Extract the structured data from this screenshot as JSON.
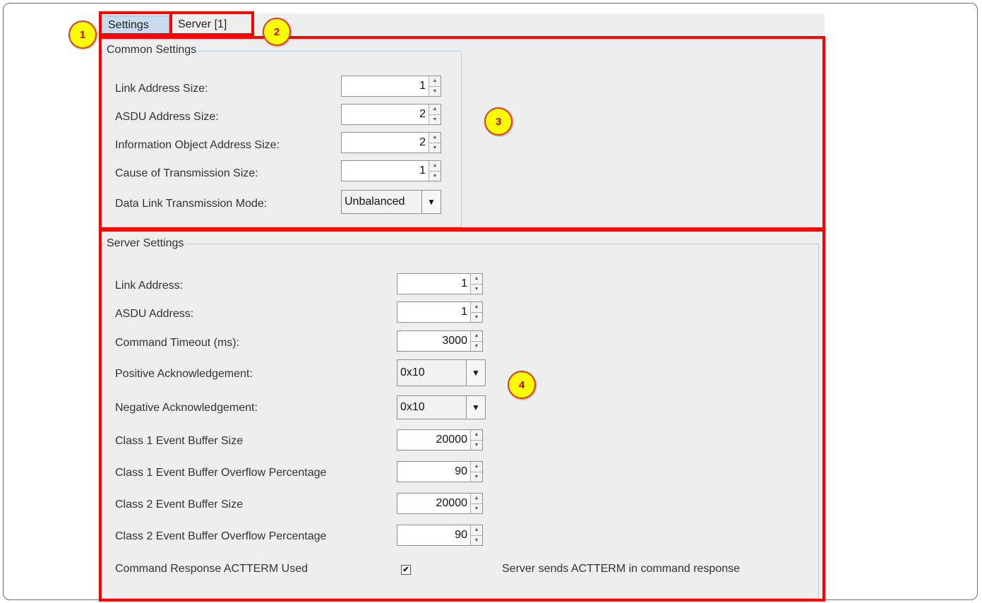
{
  "tabs": [
    {
      "label": "Settings",
      "active": true
    },
    {
      "label": "Server [1]",
      "active": false
    }
  ],
  "markers": [
    "1",
    "2",
    "3",
    "4"
  ],
  "common_settings": {
    "title": "Common Settings",
    "link_address_size": {
      "label": "Link Address Size:",
      "value": "1"
    },
    "asdu_address_size": {
      "label": "ASDU Address Size:",
      "value": "2"
    },
    "ioa_size": {
      "label": "Information Object Address Size:",
      "value": "2"
    },
    "cot_size": {
      "label": "Cause of Transmission Size:",
      "value": "1"
    },
    "transmission_mode": {
      "label": "Data Link Transmission Mode:",
      "value": "Unbalanced"
    }
  },
  "server_settings": {
    "title": "Server Settings",
    "link_address": {
      "label": "Link Address:",
      "value": "1"
    },
    "asdu_address": {
      "label": "ASDU Address:",
      "value": "1"
    },
    "command_timeout": {
      "label": "Command Timeout (ms):",
      "value": "3000"
    },
    "positive_ack": {
      "label": "Positive Acknowledgement:",
      "value": "0x10"
    },
    "negative_ack": {
      "label": "Negative Acknowledgement:",
      "value": "0x10"
    },
    "class1_buffer_size": {
      "label": "Class 1 Event Buffer Size",
      "value": "20000"
    },
    "class1_overflow": {
      "label": "Class 1 Event Buffer Overflow Percentage",
      "value": "90"
    },
    "class2_buffer_size": {
      "label": "Class 2 Event Buffer Size",
      "value": "20000"
    },
    "class2_overflow": {
      "label": "Class 2 Event Buffer Overflow Percentage",
      "value": "90"
    },
    "actterm": {
      "label": "Command Response ACTTERM Used",
      "checked": true,
      "description": "Server sends ACTTERM in command response"
    }
  },
  "colors": {
    "highlight": "#ff0000",
    "marker_fill": "#ffff00",
    "panel": "#eeeeee"
  }
}
